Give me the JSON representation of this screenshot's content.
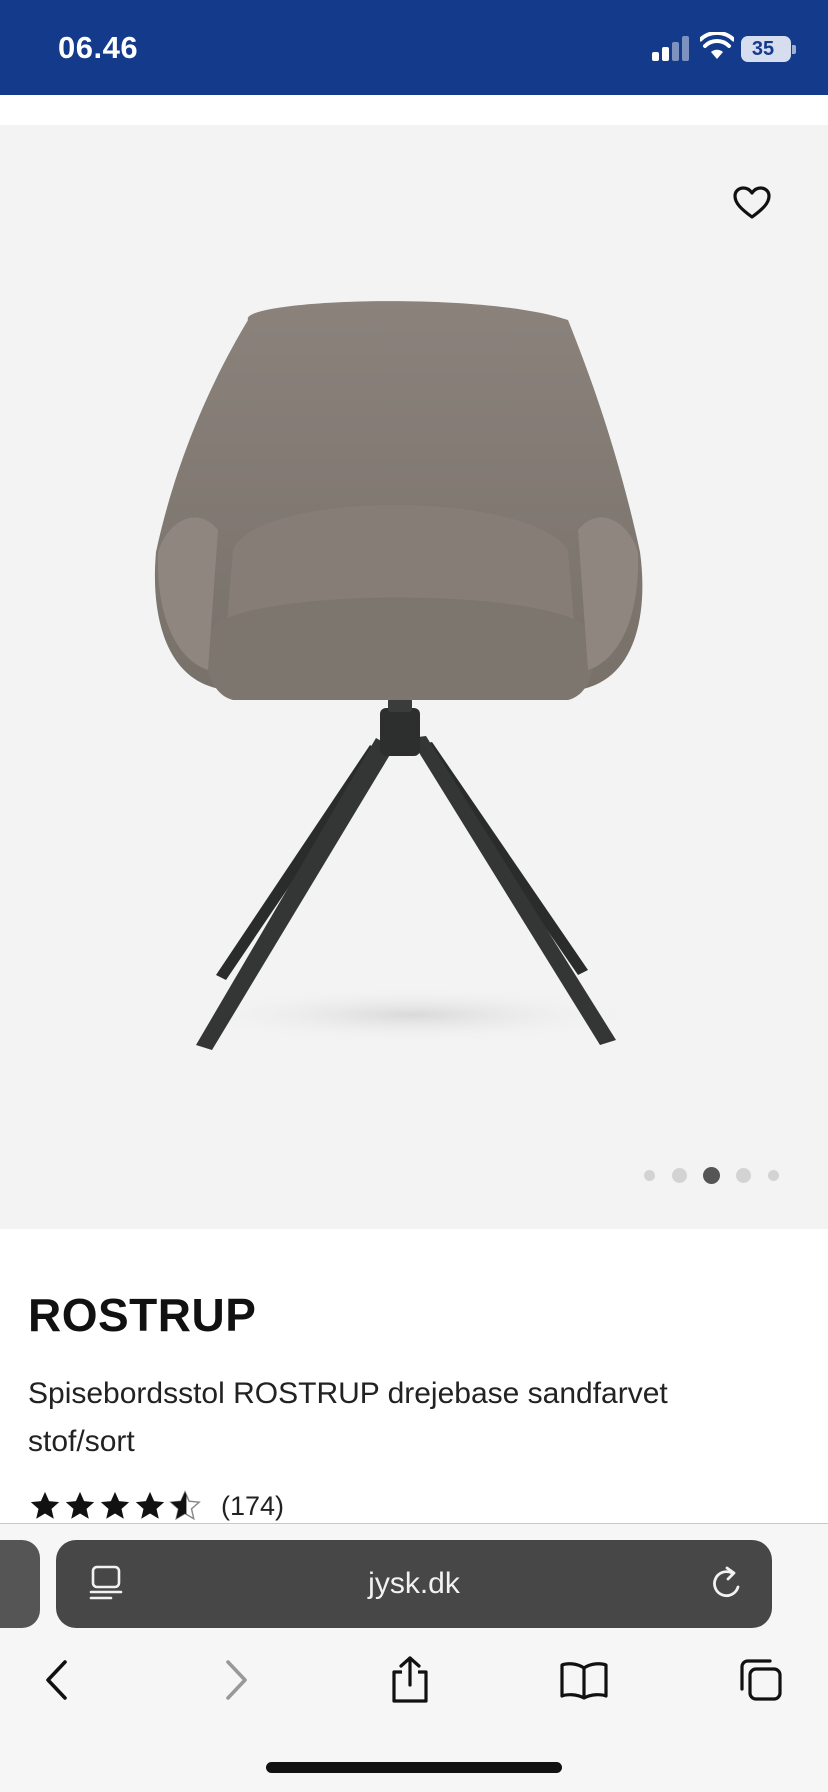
{
  "status_bar": {
    "time": "06.46",
    "battery_level": "35"
  },
  "gallery": {
    "favorite_icon": "heart-outline-icon",
    "image_subject": "chair",
    "dots_count": 5,
    "active_dot": 3
  },
  "product": {
    "name": "ROSTRUP",
    "description": "Spisebordsstol ROSTRUP drejebase sandfarvet stof/sort",
    "rating": 4.5,
    "review_count": "(174)"
  },
  "browser": {
    "url": "jysk.dk",
    "icons": {
      "reader": "reader-icon",
      "reload": "reload-icon",
      "back": "chevron-left-icon",
      "forward": "chevron-right-icon",
      "share": "share-icon",
      "bookmarks": "book-icon",
      "tabs": "tabs-icon"
    }
  },
  "colors": {
    "status_bar_bg": "#143a8c",
    "gallery_bg": "#f3f3f3",
    "address_bar_bg": "#474747",
    "toolbar_bg": "#f6f6f6"
  }
}
